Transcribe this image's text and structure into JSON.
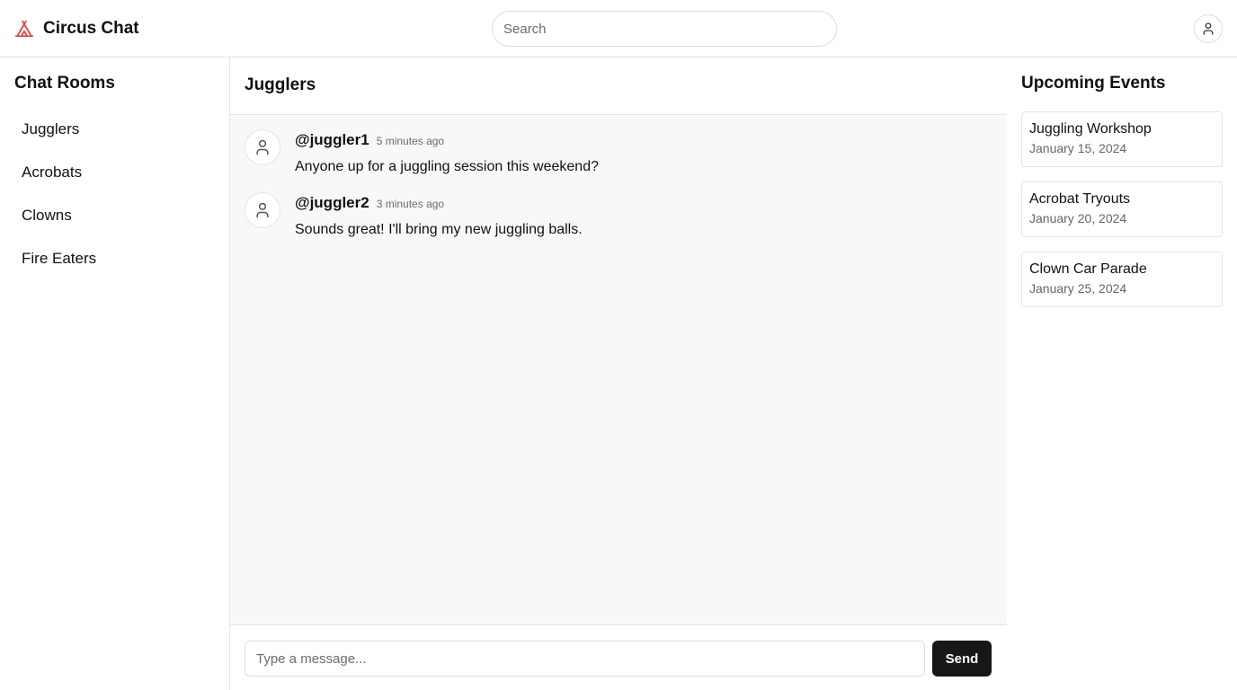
{
  "app": {
    "name": "Circus Chat",
    "logo_icon": "tent-icon",
    "accent_color": "#d94a4a"
  },
  "header": {
    "search_placeholder": "Search",
    "profile_icon": "user-icon"
  },
  "sidebar": {
    "title": "Chat Rooms",
    "rooms": [
      {
        "label": "Jugglers"
      },
      {
        "label": "Acrobats"
      },
      {
        "label": "Clowns"
      },
      {
        "label": "Fire Eaters"
      }
    ]
  },
  "main": {
    "room_title": "Jugglers",
    "messages": [
      {
        "user": "@juggler1",
        "time": "5 minutes ago",
        "text": "Anyone up for a juggling session this weekend?",
        "avatar_icon": "user-icon"
      },
      {
        "user": "@juggler2",
        "time": "3 minutes ago",
        "text": "Sounds great! I'll bring my new juggling balls.",
        "avatar_icon": "user-icon"
      }
    ],
    "composer": {
      "placeholder": "Type a message...",
      "send_label": "Send"
    }
  },
  "events": {
    "title": "Upcoming Events",
    "items": [
      {
        "name": "Juggling Workshop",
        "date": "January 15, 2024"
      },
      {
        "name": "Acrobat Tryouts",
        "date": "January 20, 2024"
      },
      {
        "name": "Clown Car Parade",
        "date": "January 25, 2024"
      }
    ]
  }
}
